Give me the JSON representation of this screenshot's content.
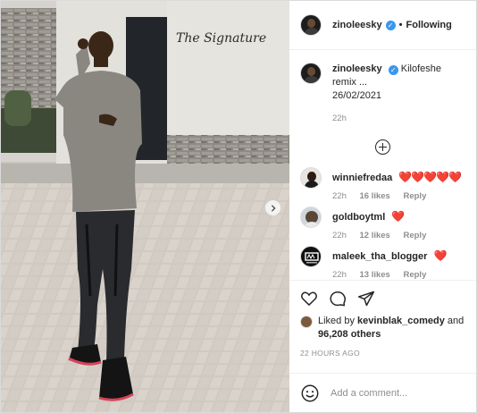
{
  "photo": {
    "sign_text": "The Signature",
    "alt": "photo-post-image"
  },
  "post": {
    "author": "zinoleesky",
    "follow_status": "Following",
    "caption": {
      "username": "zinoleesky",
      "text": "Kilofeshe remix ...",
      "date_line": "26/02/2021",
      "time": "22h"
    }
  },
  "comments": [
    {
      "username": "winniefredaa",
      "text": "❤️❤️❤️❤️❤️",
      "time": "22h",
      "likes": "16 likes",
      "reply": "Reply"
    },
    {
      "username": "goldboytml",
      "text": "❤️",
      "time": "22h",
      "likes": "12 likes",
      "reply": "Reply"
    },
    {
      "username": "maleek_tha_blogger",
      "text": "❤️",
      "time": "22h",
      "likes": "13 likes",
      "reply": "Reply"
    }
  ],
  "likes": {
    "prefix": "Liked by ",
    "liker": "kevinblak_comedy",
    "joiner": " and",
    "count": "96,208 others"
  },
  "timestamp": "22 HOURS AGO",
  "add_comment": {
    "placeholder": "Add a comment..."
  },
  "icons": {
    "verified": "verified-badge-icon",
    "like": "heart-icon",
    "comment": "comment-bubble-icon",
    "share": "paper-plane-icon",
    "emoji": "smiley-icon",
    "more": "plus-circle-icon",
    "next": "chevron-right-icon"
  },
  "colors": {
    "verified": "#3897f0",
    "heart": "#ed4956",
    "muted": "#8e8e8e",
    "text": "#262626"
  }
}
